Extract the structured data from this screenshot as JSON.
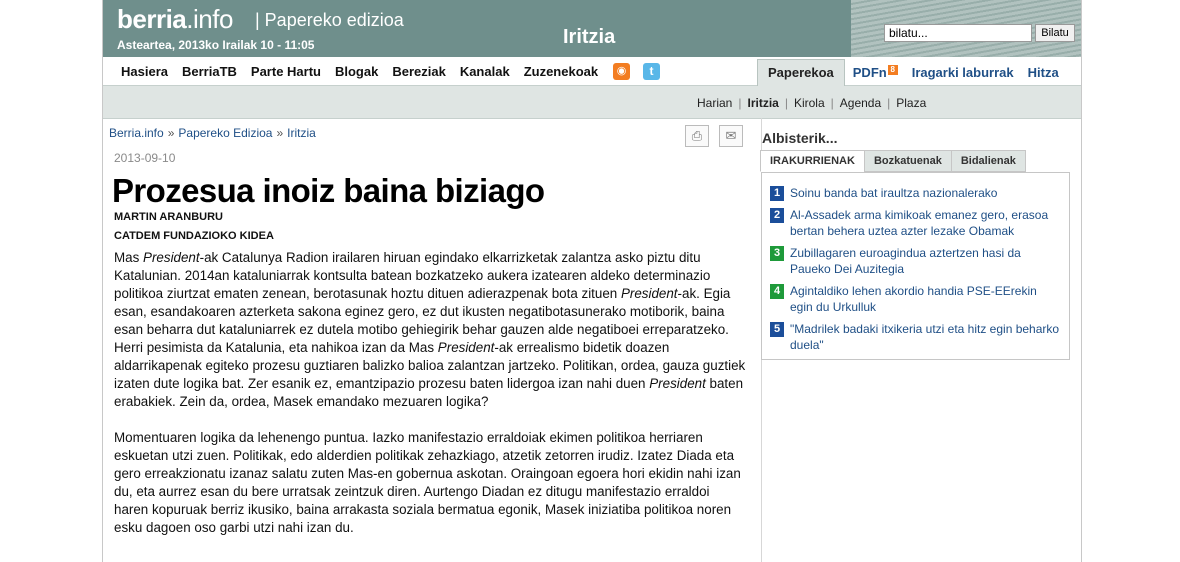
{
  "header": {
    "brand_main": "berria",
    "brand_suffix": ".info",
    "brand_sub": "| Papereko edizioa",
    "dateline": "Asteartea, 2013ko Irailak 10 - 11:05",
    "section_title": "Iritzia",
    "search": {
      "value": "bilatu...",
      "button": "Bilatu"
    }
  },
  "nav": {
    "left": [
      "Hasiera",
      "BerriaTB",
      "Parte Hartu",
      "Blogak",
      "Bereziak",
      "Kanalak",
      "Zuzenekoak"
    ],
    "rss_icon": "rss-icon",
    "twitter_icon": "twitter-icon",
    "right_active": "Paperekoa",
    "pdf_label": "PDFn",
    "pdf_badge": "8",
    "right_links": [
      "Iragarki laburrak",
      "Hitza"
    ]
  },
  "subnav": {
    "items": [
      "Harian",
      "Iritzia",
      "Kirola",
      "Agenda",
      "Plaza"
    ],
    "current": "Iritzia"
  },
  "breadcrumb": [
    "Berria.info",
    "Papereko Edizioa",
    "Iritzia"
  ],
  "breadcrumb_sep": "»",
  "article": {
    "date": "2013-09-10",
    "headline": "Prozesua inoiz baina biziago",
    "author": "MARTIN ARANBURU",
    "author_role": "CATDEM FUNDAZIOKO KIDEA",
    "p1_parts": [
      "Mas ",
      "President",
      "-ak Catalunya Radion irailaren hiruan egindako elkarrizketak zalantza asko piztu ditu Katalunian. 2014an kataluniarrak kontsulta batean bozkatzeko aukera izatearen aldeko determinazio politikoa ziurtzat ematen zenean, berotasunak hoztu dituen adierazpenak bota zituen ",
      "President",
      "-ak. Egia esan, esandakoaren azterketa sakona eginez gero, ez dut ikusten negatibotasunerako motiborik, baina esan beharra dut kataluniarrek ez dutela motibo gehiegirik behar gauzen alde negatiboei erreparatzeko. Herri pesimista da Katalunia, eta nahikoa izan da Mas ",
      "President",
      "-ak errealismo bidetik doazen aldarrikapenak egiteko prozesu guztiaren balizko balioa zalantzan jartzeko. Politikan, ordea, gauza guztiek izaten dute logika bat. Zer esanik ez, emantzipazio prozesu baten lidergoa izan nahi duen ",
      "President",
      " baten erabakiek. Zein da, ordea, Masek emandako mezuaren logika?"
    ],
    "p2": "Momentuaren logika da lehenengo puntua. Iazko manifestazio erraldoiak ekimen politikoa herriaren eskuetan utzi zuen. Politikak, edo alderdien politikak zehazkiago, atzetik zetorren irudiz. Izatez Diada eta gero erreakzionatu izanaz salatu zuten Mas-en gobernua askotan. Oraingoan egoera hori ekidin nahi izan du, eta aurrez esan du bere urratsak zeintzuk diren. Aurtengo Diadan ez ditugu manifestazio erraldoi haren kopuruak berriz ikusiko, baina arrakasta soziala bermatua egonik, Masek iniziatiba politikoa noren esku dagoen oso garbi utzi nahi izan du."
  },
  "toolbar_icons": {
    "print": "print-icon",
    "share": "share-icon"
  },
  "sidebar": {
    "title": "Albisterik...",
    "tabs": [
      "IRAKURRIENAK",
      "Bozkatuenak",
      "Bidalienak"
    ],
    "active_tab": "IRAKURRIENAK",
    "items": [
      {
        "num": "1",
        "color": "#1b4e9a",
        "text": "Soinu banda bat iraultza nazionalerako"
      },
      {
        "num": "2",
        "color": "#1b4e9a",
        "text": "Al-Assadek arma kimikoak emanez gero, erasoa bertan behera uztea azter lezake Obamak"
      },
      {
        "num": "3",
        "color": "#1e9a3a",
        "text": "Zubillagaren euroagindua aztertzen hasi da Paueko Dei Auzitegia"
      },
      {
        "num": "4",
        "color": "#1e9a3a",
        "text": "Agintaldiko lehen akordio handia PSE-EErekin egin du Urkulluk"
      },
      {
        "num": "5",
        "color": "#1b4e9a",
        "text": "\"Madrilek badaki itxikeria utzi eta hitz egin beharko duela\""
      }
    ]
  }
}
